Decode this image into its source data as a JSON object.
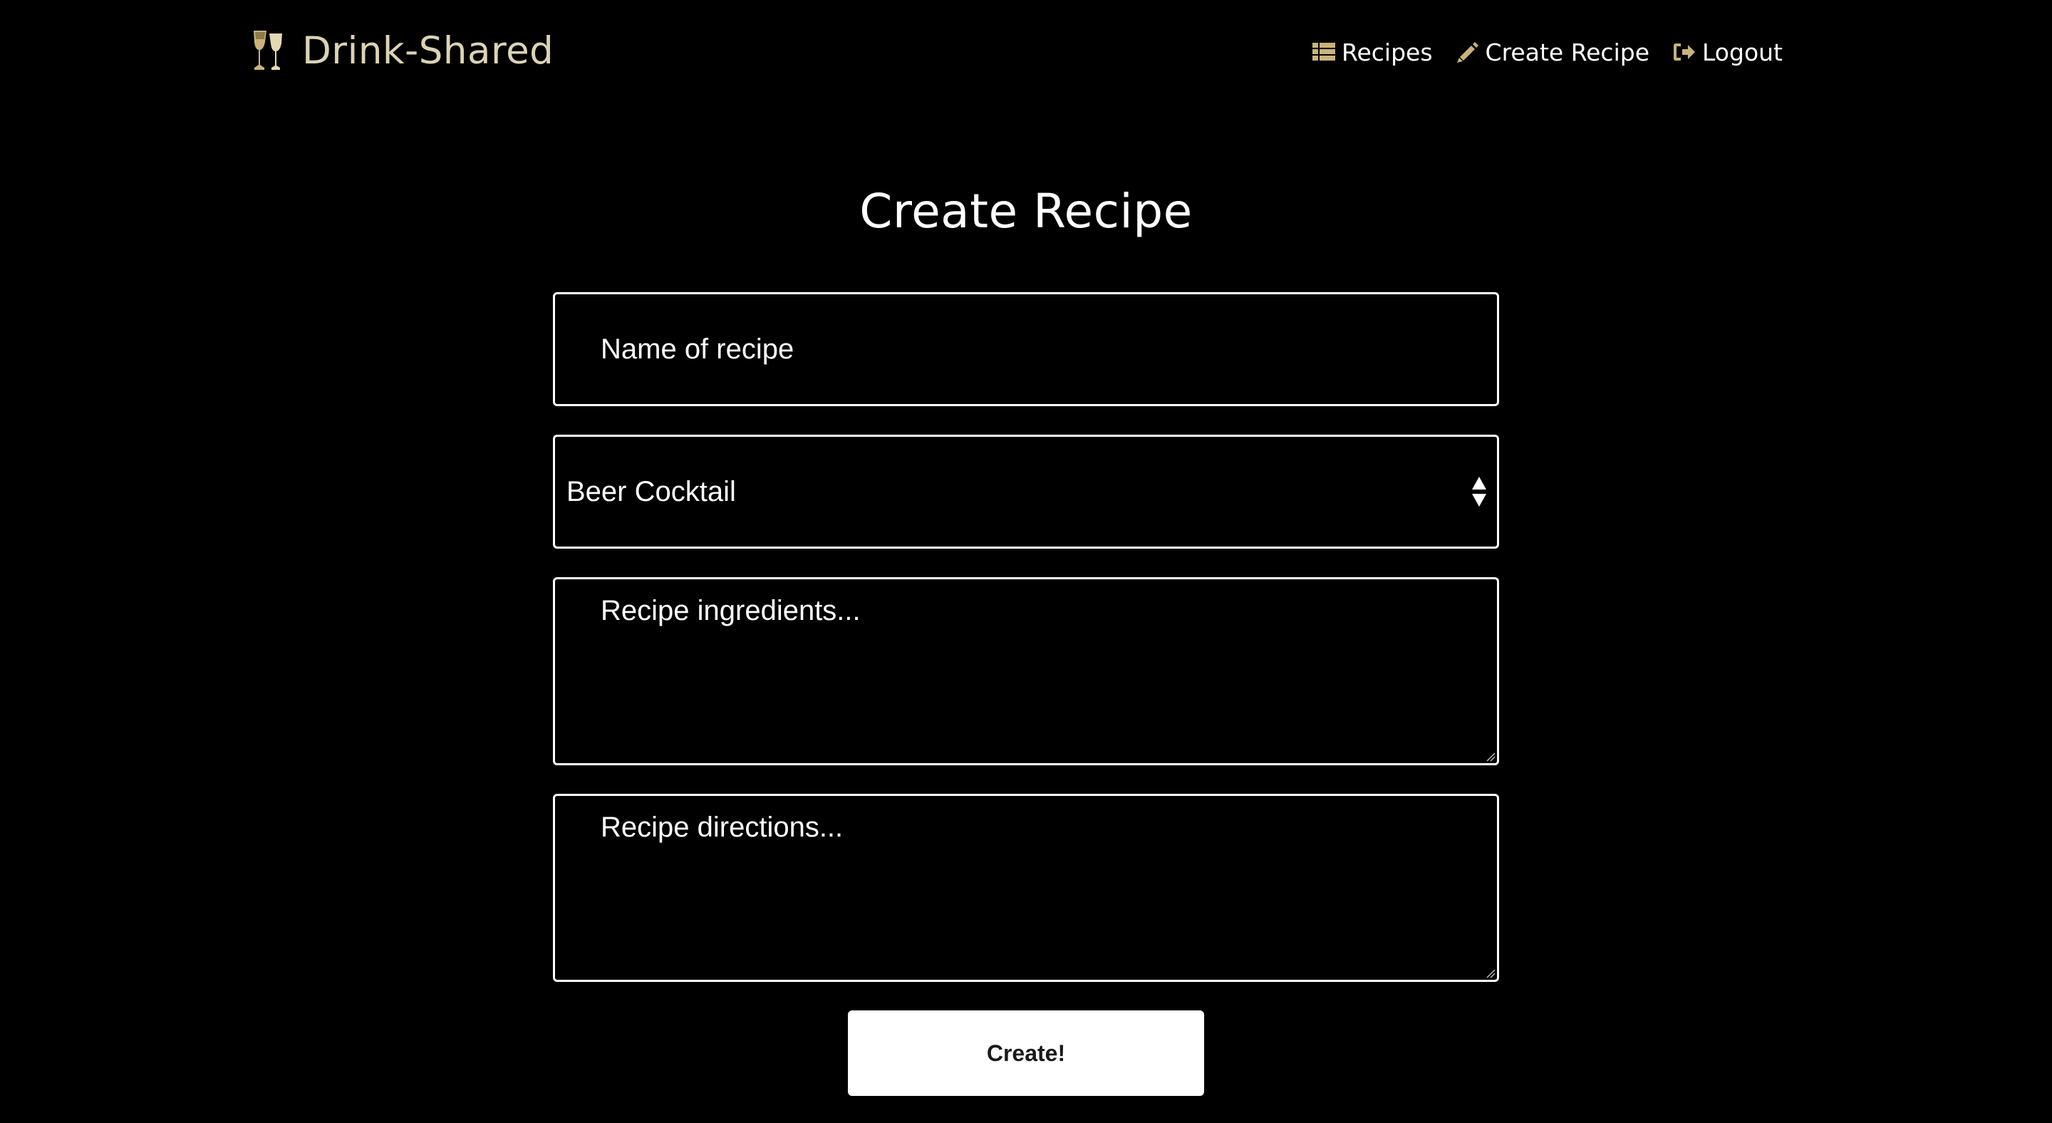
{
  "app": {
    "brand_name": "Drink-Shared",
    "brand_color": "#dcd3b6",
    "accent_color": "#c9b37a"
  },
  "nav": {
    "items": [
      {
        "label": "Recipes",
        "icon": "list-icon"
      },
      {
        "label": "Create Recipe",
        "icon": "pencil-icon"
      },
      {
        "label": "Logout",
        "icon": "sign-out-icon"
      }
    ]
  },
  "page": {
    "title": "Create Recipe"
  },
  "form": {
    "name_placeholder": "Name of recipe",
    "name_value": "",
    "category_selected": "Beer Cocktail",
    "ingredients_placeholder": "Recipe ingredients...",
    "directions_placeholder": "Recipe directions...",
    "submit_label": "Create!"
  }
}
